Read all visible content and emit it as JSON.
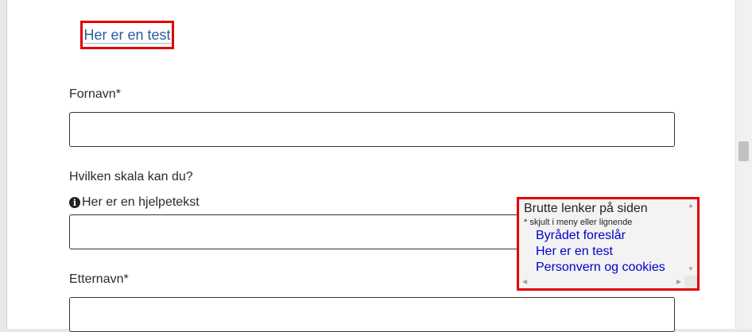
{
  "top_link": {
    "label": "Her er en test"
  },
  "form": {
    "first_name_label": "Fornavn*",
    "scale_label": "Hvilken skala kan du?",
    "help_text": "Her er en hjelpetekst",
    "last_name_label": "Etternavn*",
    "first_name_value": "",
    "scale_value": "",
    "last_name_value": ""
  },
  "panel": {
    "title": "Brutte lenker på siden",
    "subtitle": "* skjult i meny eller lignende",
    "links": [
      "Byrådet foreslår",
      "Her er en test",
      "Personvern og cookies"
    ]
  },
  "icons": {
    "info": "info-icon"
  },
  "colors": {
    "highlight": "#e00000",
    "link": "#2a5d9f",
    "panel_link": "#0000cc"
  }
}
